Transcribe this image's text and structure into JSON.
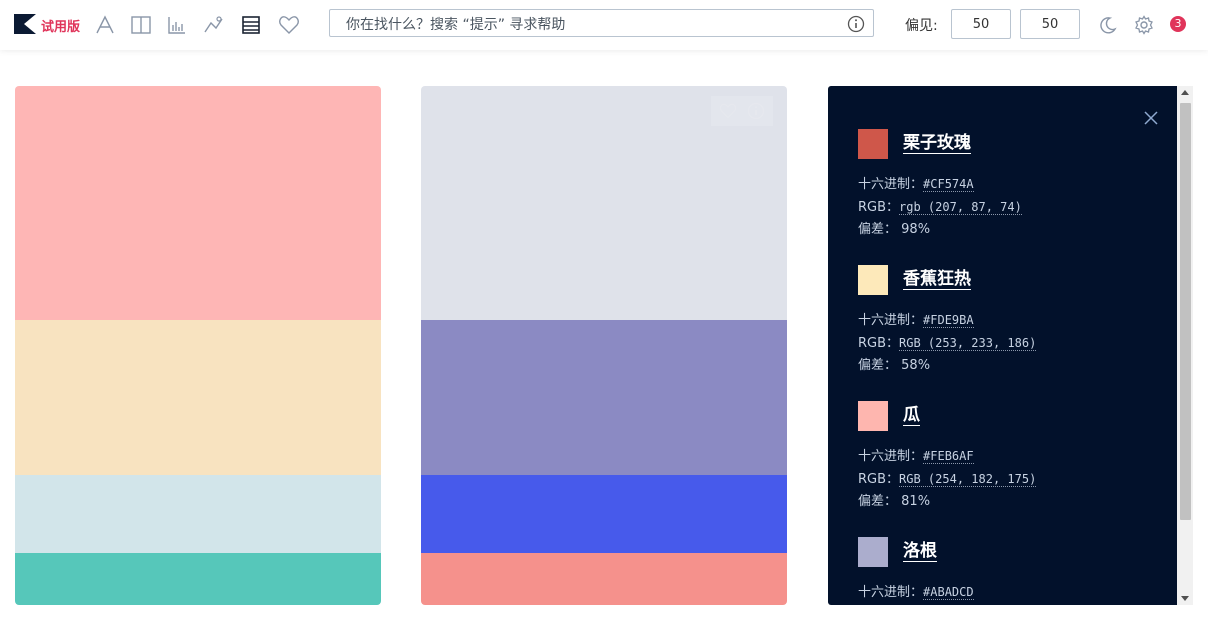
{
  "header": {
    "logo_icon": "k-logo-icon",
    "trial_label": "试用版",
    "tools": [
      {
        "name": "font-icon"
      },
      {
        "name": "split-columns-icon"
      },
      {
        "name": "bar-chart-icon"
      },
      {
        "name": "line-chart-icon"
      },
      {
        "name": "stacked-rows-icon"
      },
      {
        "name": "heart-icon"
      }
    ],
    "search": {
      "placeholder": "你在找什么？搜索 “提示” 寻求帮助",
      "value": ""
    },
    "bias_label": "偏见:",
    "bias_values": [
      "50",
      "50"
    ],
    "notification_count": "3",
    "accent_color": "#e0345a"
  },
  "palettes": [
    {
      "swatches": [
        "#feb6b5",
        "#f8e3c0",
        "#d2e5ea",
        "#56c7ba"
      ],
      "weights": [
        234,
        155,
        78,
        52
      ]
    },
    {
      "swatches": [
        "#dfe2ea",
        "#8b8ac3",
        "#475aeb",
        "#f5918c"
      ],
      "weights": [
        234,
        155,
        78,
        52
      ]
    }
  ],
  "panel": {
    "background": "#02112b",
    "colors": [
      {
        "swatch": "#cf574a",
        "name": "栗子玫瑰",
        "hex_label": "十六进制：",
        "hex": "#CF574A",
        "rgb_label": "RGB：",
        "rgb": "rgb (207, 87, 74)",
        "bias_label": "偏差：",
        "bias": "98%"
      },
      {
        "swatch": "#fde9ba",
        "name": "香蕉狂热",
        "hex_label": "十六进制：",
        "hex": "#FDE9BA",
        "rgb_label": "RGB：",
        "rgb": "RGB (253, 233, 186)",
        "bias_label": "偏差：",
        "bias": "58%"
      },
      {
        "swatch": "#feb6af",
        "name": "瓜",
        "hex_label": "十六进制：",
        "hex": "#FEB6AF",
        "rgb_label": "RGB：",
        "rgb": "RGB (254, 182, 175)",
        "bias_label": "偏差：",
        "bias": "81%"
      },
      {
        "swatch": "#abadcd",
        "name": "洛根",
        "hex_label": "十六进制：",
        "hex": "#ABADCD"
      }
    ]
  }
}
